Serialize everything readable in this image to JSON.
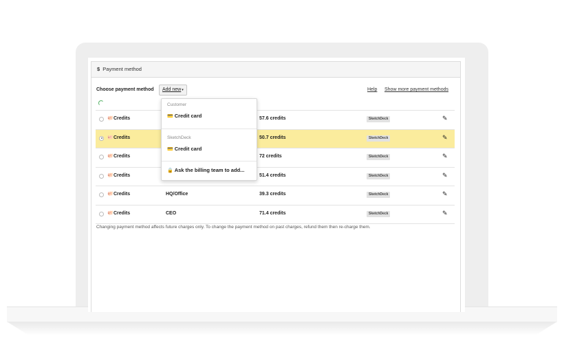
{
  "panel": {
    "title_icon": "$",
    "title": "Payment method"
  },
  "toolbar": {
    "choose_label": "Choose payment method",
    "add_new": "Add new",
    "help": "Help",
    "show_more": "Show more payment methods"
  },
  "rows": [
    {
      "label": "Credits",
      "name": "",
      "amount": "57.6 credits",
      "badge": "SketchDeck",
      "selected": false
    },
    {
      "label": "Credits",
      "name": "",
      "amount": "50.7 credits",
      "badge": "SketchDeck",
      "selected": true
    },
    {
      "label": "Credits",
      "name": "",
      "amount": "72 credits",
      "badge": "SketchDeck",
      "selected": false
    },
    {
      "label": "Credits",
      "name": "",
      "amount": "51.4 credits",
      "badge": "SketchDeck",
      "selected": false
    },
    {
      "label": "Credits",
      "name": "HQ/Office",
      "amount": "39.3 credits",
      "badge": "SketchDeck",
      "selected": false
    },
    {
      "label": "Credits",
      "name": "CEO",
      "amount": "71.4 credits",
      "badge": "SketchDeck",
      "selected": false
    }
  ],
  "footer_note": "Changing payment method affects future charges only. To change the payment method on past charges, refund them then re-charge them.",
  "dropdown": {
    "group1": "Customer",
    "item1": "Credit card",
    "group2": "SketchDeck",
    "item2": "Credit card",
    "item3": "Ask the billing team to add..."
  },
  "colors": {
    "highlight": "#fbec9d",
    "spinner": "#58b368"
  },
  "icons": {
    "credits": "piggy-bank-icon",
    "edit": "pencil-icon",
    "card": "credit-card-icon",
    "lock": "lock-icon"
  }
}
